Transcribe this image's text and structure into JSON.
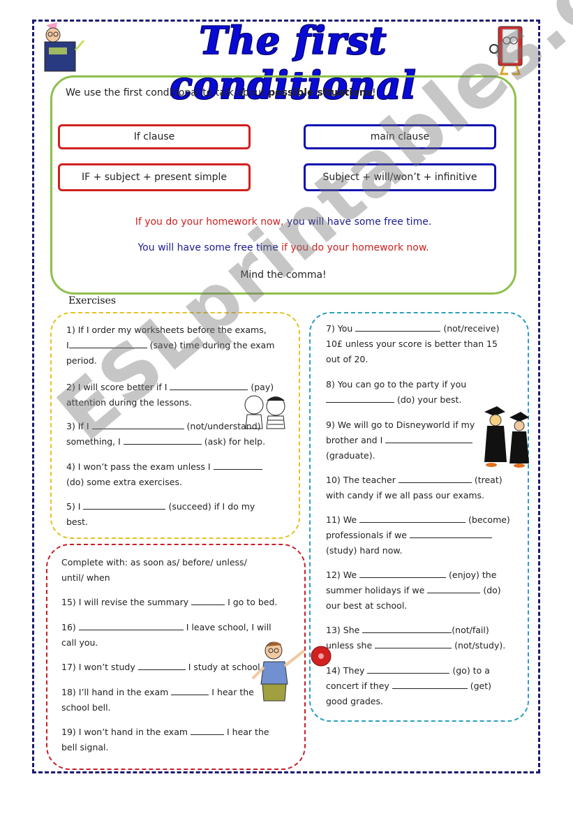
{
  "title": "The first conditional",
  "rule_box": {
    "intro_prefix": "We use the first conditional to talk about ",
    "intro_bold": "possible situations",
    "intro_suffix": "!",
    "if_clause_label": "If clause",
    "main_clause_label": "main clause",
    "if_clause_formula": "IF + subject + present simple",
    "main_clause_formula": "Subject + will/won’t + infinitive",
    "example1_red": "If you do your homework now,",
    "example1_blue": " you will have some free time.",
    "example2_blue": "You will have some free time ",
    "example2_red": "if you do your homework now.",
    "note": "Mind the comma!"
  },
  "exercises_label": "Exercises",
  "yellow_box": {
    "q1a": "1) If I order my worksheets before the exams,",
    "q1b_pre": "I",
    "q1b_post": "(save) time during the exam",
    "q1c": "period.",
    "q2a_pre": "2) I will score better if I",
    "q2a_post": "(pay)",
    "q2b": "attention during the lessons.",
    "q3a_pre": "3) If I",
    "q3a_post": "(not/understand)",
    "q3b_pre": "something, I",
    "q3b_post": "(ask) for help.",
    "q4a": "4) I won’t pass the exam unless I",
    "q4b": "(do) some extra exercises.",
    "q5a_pre": "5) I",
    "q5a_post": "(succeed) if I do my",
    "q5b": "best."
  },
  "teal_box": {
    "q7a_pre": "7) You",
    "q7a_post": "(not/receive)",
    "q7b": "10£ unless your score is better than 15",
    "q7c": "out of 20.",
    "q8a": "8) You can go to the party if you",
    "q8b_post": "(do) your best.",
    "q9a": "9) We will go to Disneyworld if my",
    "q9b_pre": "brother and I",
    "q9c": "(graduate).",
    "q10a_pre": "10) The teacher",
    "q10a_post": "(treat)",
    "q10b": "with candy if we all pass our exams.",
    "q11a_pre": "11) We",
    "q11a_post": "(become)",
    "q11b_pre": "professionals if we",
    "q11c": "(study) hard now.",
    "q12a_pre": "12)  We",
    "q12a_post": "(enjoy) the",
    "q12b_pre": "summer holidays if we",
    "q12b_post": "(do)",
    "q12c": "our best at school.",
    "q13a_pre": "13) She",
    "q13a_post": "(not/fail)",
    "q13b_pre": "unless she",
    "q13b_post": "(not/study).",
    "q14a_pre": "14) They",
    "q14a_post": "(go) to a",
    "q14b_pre": "concert if they",
    "q14b_post": "(get)",
    "q14c": "good grades."
  },
  "red_box": {
    "instruction_a": "Complete with: as soon as/ before/ unless/",
    "instruction_b": "until/ when",
    "q15_pre": "15) I will revise the summary",
    "q15_post": "I go to bed.",
    "q16_pre": "16)",
    "q16_post": "I leave school, I will",
    "q16b": "call you.",
    "q17_pre": "17) I won’t study",
    "q17_post": "I study at school.",
    "q18_pre": "18) I’ll hand in the exam",
    "q18_post": "I hear the",
    "q18b": "school bell.",
    "q19_pre": "19) I won’t hand in the exam",
    "q19_post": "I hear the",
    "q19b": "bell signal."
  },
  "watermark": "ESLprintables.com",
  "colors": {
    "title": "#0a0ad6",
    "rule_border": "#8cc04a",
    "if_clause_border": "#d0201e",
    "main_clause_border": "#1010b0",
    "yellow_border": "#e8c020",
    "teal_border": "#2a9fbf",
    "red_border": "#c81e28"
  }
}
